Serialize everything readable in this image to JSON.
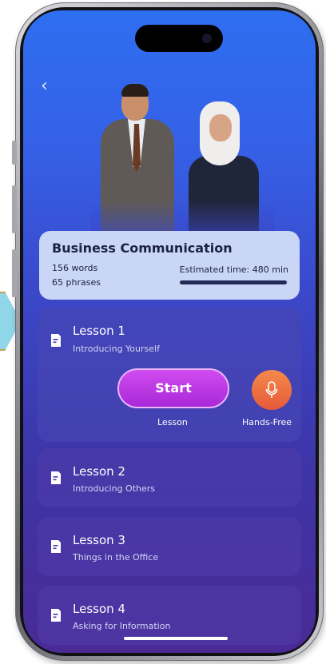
{
  "nav": {
    "back_glyph": "‹"
  },
  "course": {
    "title": "Business Communication",
    "words": "156 words",
    "phrases": "65 phrases",
    "estimated_time": "Estimated time: 480 min",
    "progress": 1.0
  },
  "lessons": [
    {
      "title": "Lesson 1",
      "subtitle": "Introducing Yourself"
    },
    {
      "title": "Lesson 2",
      "subtitle": "Introducing Others"
    },
    {
      "title": "Lesson 3",
      "subtitle": "Things in the Office"
    },
    {
      "title": "Lesson 4",
      "subtitle": "Asking for Information"
    }
  ],
  "actions": {
    "start_label": "Start",
    "start_caption": "Lesson",
    "handsfree_caption": "Hands-Free"
  },
  "colors": {
    "accent_start": "#b530e0",
    "mic": "#ee6c42",
    "card": "#c9d6f6"
  },
  "icons": [
    "back-icon",
    "document-icon",
    "microphone-icon"
  ]
}
